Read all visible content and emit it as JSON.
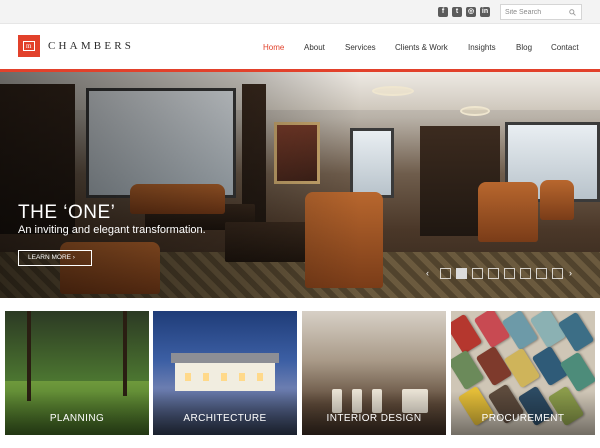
{
  "topbar": {
    "social": [
      {
        "name": "facebook-icon",
        "glyph": "f"
      },
      {
        "name": "twitter-icon",
        "glyph": "t"
      },
      {
        "name": "instagram-icon",
        "glyph": "◎"
      },
      {
        "name": "linkedin-icon",
        "glyph": "in"
      }
    ],
    "search": {
      "placeholder": "Site Search",
      "icon": "search-icon"
    }
  },
  "header": {
    "logo_mark": "m",
    "logo_text": "CHAMBERS",
    "nav": [
      "Home",
      "About",
      "Services",
      "Clients & Work",
      "Insights",
      "Blog",
      "Contact"
    ],
    "active_nav": "Home"
  },
  "hero": {
    "title": "THE ‘ONE’",
    "subtitle": "An inviting and elegant transformation.",
    "button_label": "LEARN MORE ›",
    "prev_arrow": "‹",
    "next_arrow": "›",
    "slide_count": 9,
    "active_slide": 1
  },
  "tiles": [
    {
      "label": "PLANNING"
    },
    {
      "label": "ARCHITECTURE"
    },
    {
      "label": "INTERIOR DESIGN"
    },
    {
      "label": "PROCUREMENT"
    }
  ],
  "colors": {
    "accent": "#e2412b",
    "text": "#333333",
    "topbar": "#f3f3f3"
  }
}
